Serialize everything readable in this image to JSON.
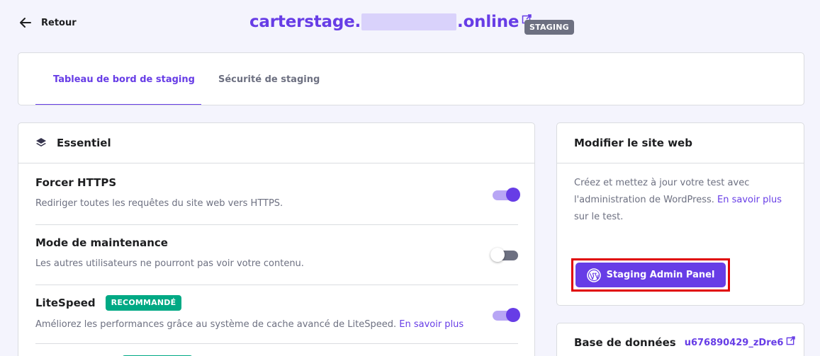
{
  "header": {
    "back_label": "Retour",
    "site_prefix": "carterstage.",
    "site_suffix": ".online",
    "badge": "STAGING"
  },
  "tabs": [
    {
      "label": "Tableau de bord de staging",
      "active": true
    },
    {
      "label": "Sécurité de staging",
      "active": false
    }
  ],
  "essentiel": {
    "title": "Essentiel",
    "settings": [
      {
        "title": "Forcer HTTPS",
        "description": "Rediriger toutes les requêtes du site web vers HTTPS.",
        "enabled": true
      },
      {
        "title": "Mode de maintenance",
        "description": "Les autres utilisateurs ne pourront pas voir votre contenu.",
        "enabled": false
      },
      {
        "title": "LiteSpeed",
        "badge": "RECOMMANDÉ",
        "description": "Améliorez les performances grâce au système de cache avancé de LiteSpeed.",
        "link": "En savoir plus",
        "enabled": true
      }
    ]
  },
  "modifier": {
    "title": "Modifier le site web",
    "desc_part1": "Créez et mettez à jour votre test avec l'administration de WordPress.",
    "desc_link": "En savoir plus",
    "desc_part2": "sur le test.",
    "button_label": "Staging Admin Panel"
  },
  "database": {
    "title": "Base de données",
    "name": "u676890429_zDre6"
  },
  "colors": {
    "accent": "#673de6",
    "success": "#00a984",
    "highlight": "#e00000"
  }
}
